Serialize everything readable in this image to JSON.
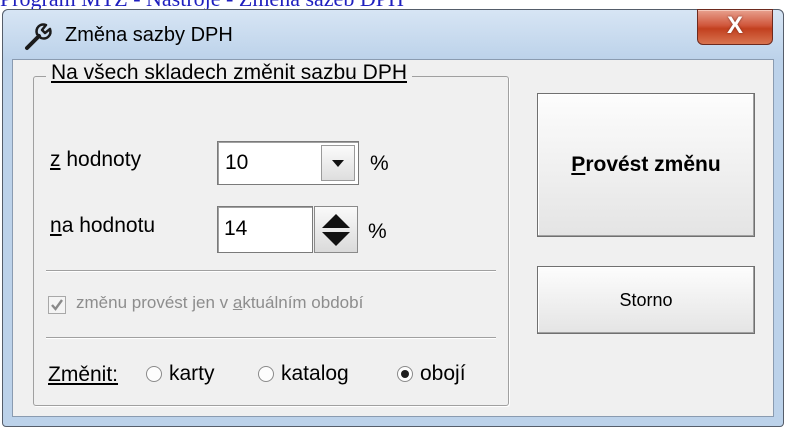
{
  "page_title": "Program MTZ - Nástroje - Změna sazeb DPH",
  "window": {
    "title": "Změna sazby DPH",
    "close_glyph": "X"
  },
  "group": {
    "legend": "Na všech skladech změnit sazbu DPH",
    "from_label_accel": "z",
    "from_label_rest": " hodnoty",
    "from_value": "10",
    "to_label_accel": "n",
    "to_label_rest": "a hodnotu",
    "to_value": "14",
    "percent": "%",
    "checkbox_label_before": "změnu provést jen v ",
    "checkbox_label_accel": "a",
    "checkbox_label_after": "ktuálním období",
    "checkbox_checked": true,
    "checkbox_enabled": false,
    "change_label": "Změnit:",
    "options": [
      {
        "label": "karty",
        "selected": false
      },
      {
        "label": "katalog",
        "selected": false
      },
      {
        "label": "obojí",
        "selected": true
      }
    ]
  },
  "buttons": {
    "execute_accel": "P",
    "execute_rest": "rovést změnu",
    "cancel": "Storno"
  },
  "icons": {
    "app": "wrench-icon",
    "close": "close-icon",
    "dropdown": "chevron-down-icon",
    "spinner": "spinner-arrows-icon",
    "check": "check-icon"
  }
}
